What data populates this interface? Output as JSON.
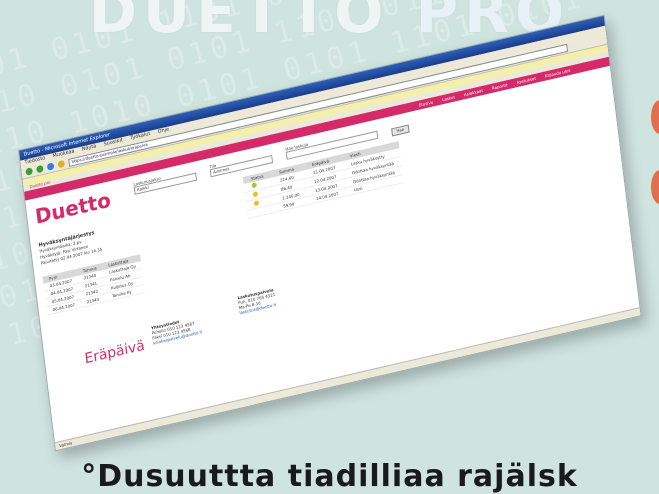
{
  "poster": {
    "headline_top": "DUETTO",
    "headline_top_suffix": "PRO",
    "caption": "°Dusuuttta tiadilliaa rajälsk",
    "watermark": "0101 0101 1101 0110 1010 0101\n1010 0101 0101 1101 0110 1010\n0110 1010 0101 0101 1101 0101\n1101 0110 1010 0101 0101 1101\n0101 1101 0110 1010 0101 0101\n1010 0101 1101 0110 1010 0101\n0101 0101 1101 0110 1010 0101\n1010 0101 0101 1101 0110 1010"
  },
  "browser": {
    "title": "Duetto - Microsoft Internet Explorer",
    "menu": [
      "Tiedosto",
      "Muokkaa",
      "Näytä",
      "Suosikit",
      "Työkalut",
      "Ohje"
    ],
    "address_value": "https://duetto.example/laskut/erapaiva",
    "links_label": "Duetto pro",
    "pinkbar_items": [
      "Etusivu",
      "Laskut",
      "Asiakkaat",
      "Raportit",
      "Asetukset",
      "Kirjaudu ulos"
    ],
    "status": "Valmis"
  },
  "page": {
    "logo": "Duetto",
    "filters": [
      {
        "label": "Laskutusjakso",
        "value": "Kaikki"
      },
      {
        "label": "Tila",
        "value": "Avoimet"
      },
      {
        "label": "Hae laskuja",
        "value": ""
      }
    ],
    "search_button": "Hae",
    "info_title": "Hyväksyntäjärjestys",
    "info_lines": [
      "Hyväksyntäaika: 2 pv",
      "Hyväksyjä: Pasi Virtanen",
      "Päivitetty 02.04.2007 klo 14.35"
    ],
    "table1": {
      "headers": [
        "Pvm",
        "Tunnus",
        "Laskuttaja"
      ],
      "rows": [
        [
          "03.04.2007",
          "21340",
          "Laskuttaja Oy"
        ],
        [
          "04.04.2007",
          "21341",
          "Palvelu Ab"
        ],
        [
          "05.04.2007",
          "21342",
          "Kuljetus Oy"
        ],
        [
          "06.04.2007",
          "21343",
          "Tarvike Ky"
        ]
      ]
    },
    "table2": {
      "headers": [
        "Status",
        "Summa",
        "Eräpäivä",
        "Viesti"
      ],
      "rows": [
        [
          "",
          "214,60",
          "11.04.2007",
          "Lasku hyväksytty"
        ],
        [
          "",
          "86,40",
          "12.04.2007",
          "Odottaa hyväksyntää"
        ],
        [
          "",
          "1 240,00",
          "13.04.2007",
          "Odottaa hyväksyntää"
        ],
        [
          "",
          "59,90",
          "14.04.2007",
          "Uusi"
        ]
      ]
    },
    "erapaiva_label": "Eräpäivä",
    "contact1": {
      "title": "Yhteystiedot",
      "lines": [
        "Puhelin 010 123 4567",
        "Faksi 010 123 4568"
      ],
      "link": "asiakaspalvelu@duetto.fi"
    },
    "contact2": {
      "title": "Laskutuspalvelu",
      "lines": [
        "Puh. 010 765 4321",
        "Ma-Pe 8-16"
      ],
      "link": "laskutus@duetto.fi"
    }
  },
  "colors": {
    "brand_pink": "#d42a6a",
    "background": "#cfe3df",
    "titlebar_blue": "#2c5fb8"
  }
}
